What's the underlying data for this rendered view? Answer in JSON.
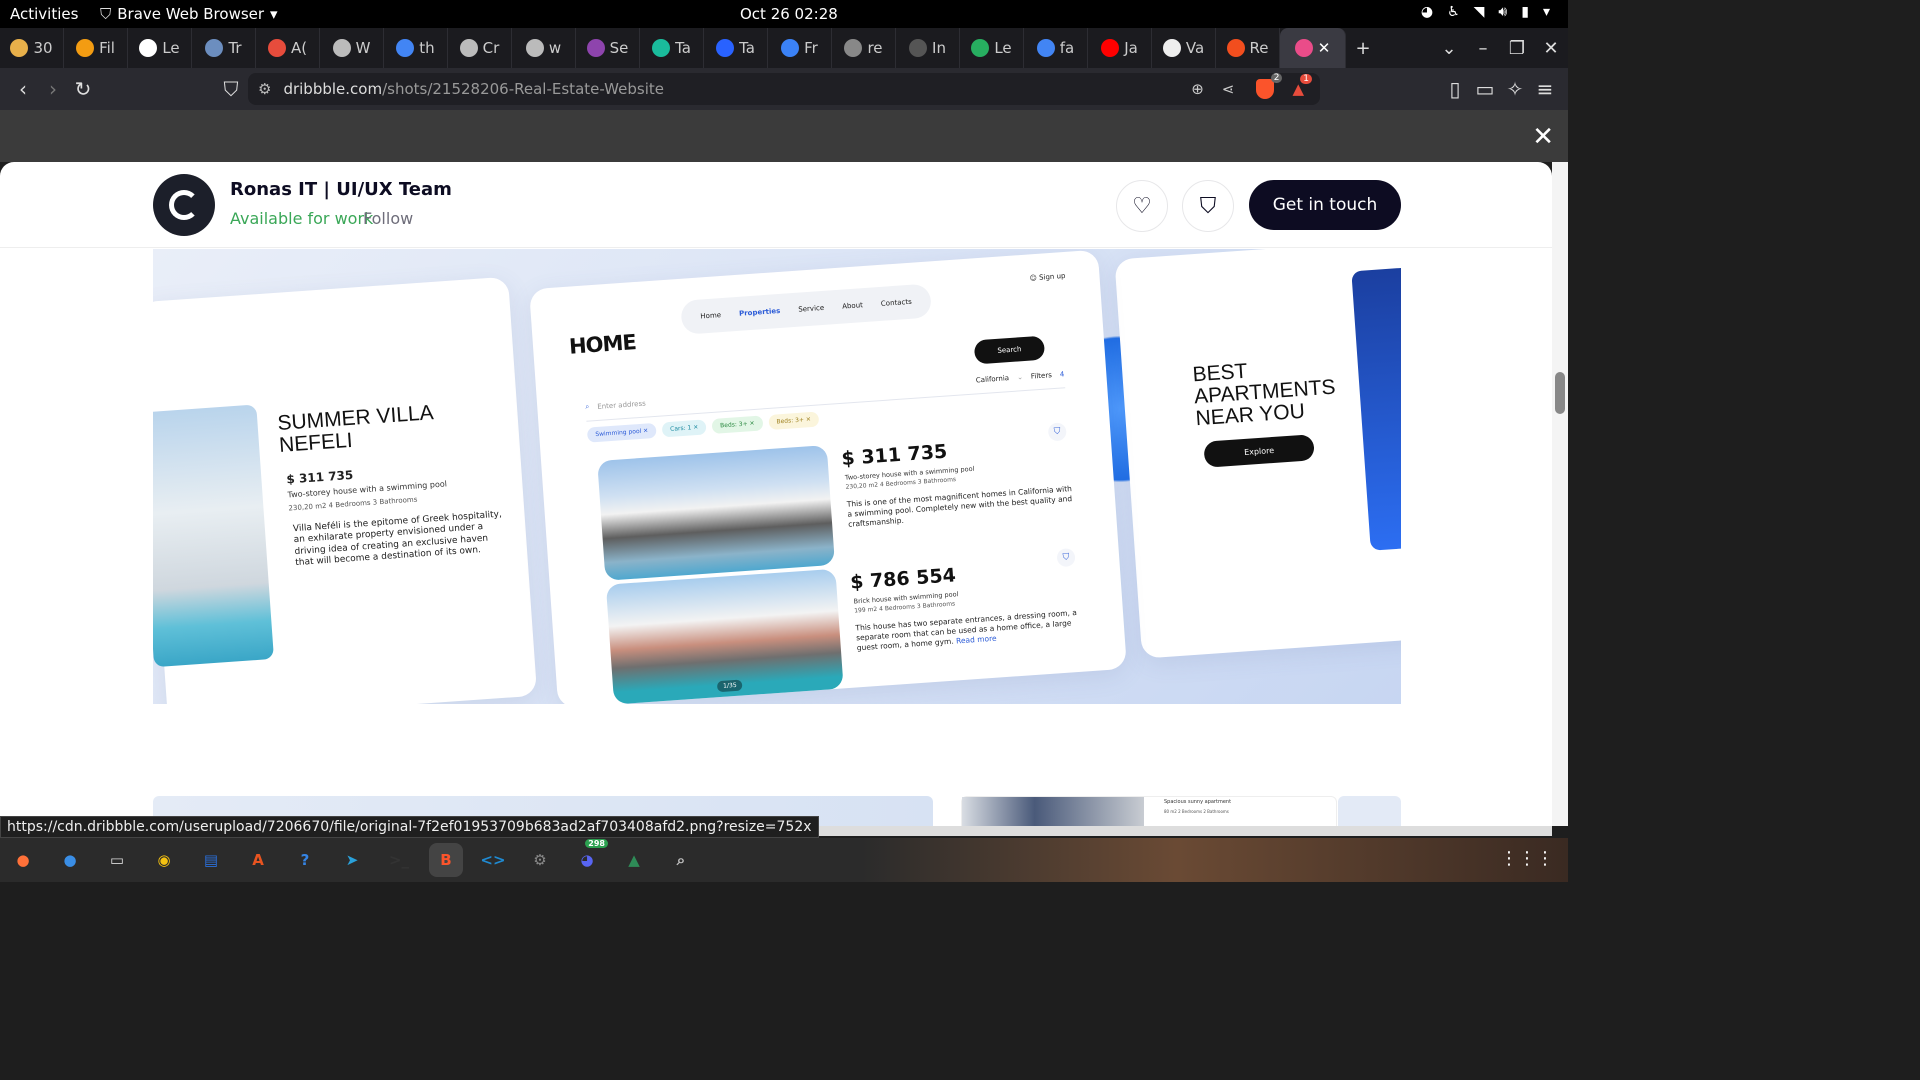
{
  "topbar": {
    "activities": "Activities",
    "app_name": "Brave Web Browser",
    "clock": "Oct 26  02:28"
  },
  "tabs": [
    {
      "label": "30",
      "color": "#e8b04a"
    },
    {
      "label": "Fil",
      "color": "#f39c12"
    },
    {
      "label": "Le",
      "color": "#ffffff"
    },
    {
      "label": "Tr",
      "color": "#6c8ebf"
    },
    {
      "label": "A(",
      "color": "#e74c3c"
    },
    {
      "label": "W",
      "color": "#bbbbbb"
    },
    {
      "label": "th",
      "color": "#4285f4"
    },
    {
      "label": "Cr",
      "color": "#bbbbbb"
    },
    {
      "label": "w",
      "color": "#bbbbbb"
    },
    {
      "label": "Se",
      "color": "#8e44ad"
    },
    {
      "label": "Ta",
      "color": "#1abc9c"
    },
    {
      "label": "Ta",
      "color": "#2962ff"
    },
    {
      "label": "Fr",
      "color": "#3b82f6"
    },
    {
      "label": "re",
      "color": "#888888"
    },
    {
      "label": "In",
      "color": "#555555"
    },
    {
      "label": "Le",
      "color": "#27ae60"
    },
    {
      "label": "fa",
      "color": "#4285f4"
    },
    {
      "label": "Ja",
      "color": "#ff0000"
    },
    {
      "label": "Va",
      "color": "#eeeeee"
    },
    {
      "label": "Re",
      "color": "#f24e1e"
    }
  ],
  "active_tab": {
    "close": "✕",
    "color": "#ea4c89"
  },
  "tab_controls": {
    "new_tab": "+",
    "dropdown": "⌄",
    "minimize": "–",
    "maximize": "❐",
    "close": "✕"
  },
  "navbar": {
    "url_domain": "dribbble.com",
    "url_path": "/shots/21528206-Real-Estate-Website",
    "brave_badge": "2",
    "alert_badge": "1"
  },
  "modal": {
    "close": "✕",
    "team_name": "Ronas IT | UI/UX Team",
    "available": "Available for work",
    "follow": "Follow",
    "cta": "Get in touch"
  },
  "shot": {
    "left_card": {
      "title": "SUMMER VILLA NEFELI",
      "price": "$ 311 735",
      "subtitle": "Two-storey house with a swimming pool",
      "meta": "230,20 m2   4 Bedrooms   3 Bathrooms",
      "description": "Villa Neféli is the epitome of Greek hospitality, an exhilarate property envisioned under a driving idea of creating an exclusive haven that will become a destination of its own."
    },
    "mid_card": {
      "logo": "HOME",
      "nav": [
        "Home",
        "Properties",
        "Service",
        "About",
        "Contacts"
      ],
      "signup": "Sign up",
      "search_placeholder": "Enter address",
      "location": "California",
      "filters": "Filters",
      "filters_count": "4",
      "search_btn": "Search",
      "chips": [
        {
          "label": "Swimming pool ✕",
          "bg": "#dfe8fb",
          "fg": "#2b5bd7"
        },
        {
          "label": "Cars: 1 ✕",
          "bg": "#dff3f7",
          "fg": "#1b8aa0"
        },
        {
          "label": "Beds: 3+ ✕",
          "bg": "#e2f6e6",
          "fg": "#2d8a43"
        },
        {
          "label": "Beds: 3+ ✕",
          "bg": "#fbf5dc",
          "fg": "#a08322"
        }
      ],
      "listings": [
        {
          "price": "$ 311 735",
          "subtitle": "Two-storey house with a swimming pool",
          "meta": "230,20 m2   4 Bedrooms   3 Bathrooms",
          "description": "This is one of the most magnificent homes in California with a swimming pool. Completely new with the best quality and craftsmanship.",
          "read_more": ""
        },
        {
          "price": "$ 786 554",
          "subtitle": "Brick house with swimming pool",
          "meta": "199 m2   4 Bedrooms   3 Bathrooms",
          "description": "This house has two separate entrances, a dressing room, a separate room that can be used as a home office, a large guest room, a home gym.",
          "read_more": "Read more"
        }
      ],
      "counter": "1/35"
    },
    "right_card": {
      "title": "BEST APARTMENTS NEAR YOU",
      "explore": "Explore"
    }
  },
  "below": {
    "caption": "Spacious sunny apartment",
    "meta": "80 m2   2 Bedrooms   2 Bathrooms"
  },
  "status_url": "https://cdn.dribbble.com/userupload/7206670/file/original-7f2ef01953709b683ad2af703408afd2.png?resize=752x",
  "dock": [
    {
      "name": "firefox-icon",
      "glyph": "●",
      "color": "#ff7139"
    },
    {
      "name": "thunderbird-icon",
      "glyph": "●",
      "color": "#3a8ee6"
    },
    {
      "name": "files-icon",
      "glyph": "▭",
      "color": "#d9d9d9"
    },
    {
      "name": "rhythmbox-icon",
      "glyph": "◉",
      "color": "#f5c211"
    },
    {
      "name": "writer-icon",
      "glyph": "▤",
      "color": "#2a6fdb"
    },
    {
      "name": "software-icon",
      "glyph": "A",
      "color": "#e95420"
    },
    {
      "name": "help-icon",
      "glyph": "?",
      "color": "#3584e4"
    },
    {
      "name": "telegram-icon",
      "glyph": "➤",
      "color": "#2aa1da"
    },
    {
      "name": "terminal-icon",
      "glyph": ">_",
      "color": "#333333"
    },
    {
      "name": "brave-icon",
      "glyph": "B",
      "color": "#fb542b"
    },
    {
      "name": "vscode-icon",
      "glyph": "<>",
      "color": "#1f8ad2"
    },
    {
      "name": "settings-icon",
      "glyph": "⚙",
      "color": "#888888"
    },
    {
      "name": "discord-icon",
      "glyph": "◕",
      "color": "#5865f2",
      "badge": "298"
    },
    {
      "name": "inkscape-icon",
      "glyph": "▲",
      "color": "#2e8b57"
    },
    {
      "name": "image-viewer-icon",
      "glyph": "⌕",
      "color": "#c0c0c0"
    }
  ],
  "dock_apps_grid": "⋮⋮⋮"
}
